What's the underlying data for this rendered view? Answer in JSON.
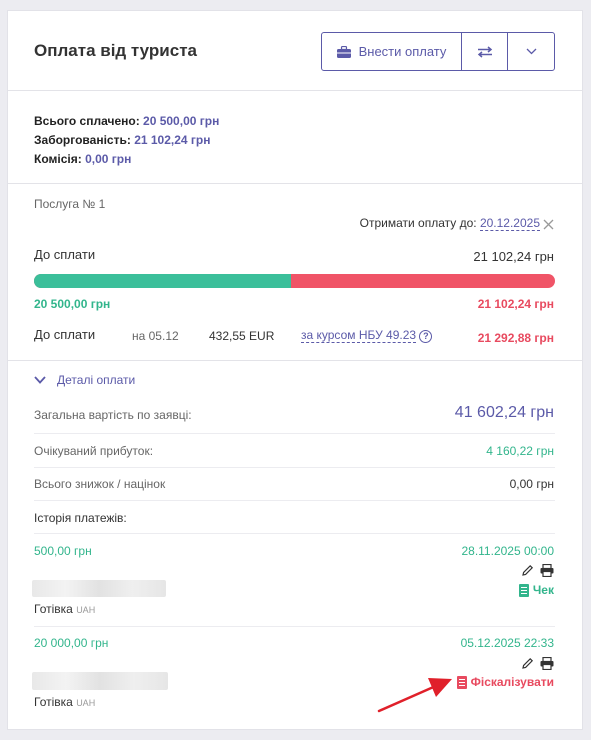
{
  "header": {
    "title": "Оплата від туриста",
    "pay_button_label": "Внести оплату"
  },
  "summary": {
    "paid_label": "Всього сплачено:",
    "paid_value": "20 500,00 грн",
    "debt_label": "Заборгованість:",
    "debt_value": "21 102,24 грн",
    "commission_label": "Комісія:",
    "commission_value": "0,00 грн"
  },
  "service": {
    "title": "Послуга № 1",
    "deadline_label": "Отримати оплату до:",
    "deadline_value": "20.12.2025",
    "to_pay_label": "До сплати",
    "to_pay_value": "21 102,24 грн",
    "paid_fraction": 0.493,
    "paid_amount": "20 500,00 грн",
    "remaining_amount": "21 102,24 грн",
    "conversion": {
      "label": "До сплати",
      "date": "на 05.12",
      "amount": "432,55 EUR",
      "rate_label": "за курсом НБУ 49.23",
      "total": "21 292,88 грн"
    }
  },
  "details": {
    "toggle_label": "Деталі оплати",
    "total_cost_label": "Загальна вартість по заявці:",
    "total_cost_value": "41 602,24 грн",
    "profit_label": "Очікуваний прибуток:",
    "profit_value": "4 160,22 грн",
    "discounts_label": "Всього знижок / націнок",
    "discounts_value": "0,00 грн",
    "history_label": "Історія платежів:"
  },
  "payments": [
    {
      "amount": "500,00 грн",
      "datetime": "28.11.2025 00:00",
      "method": "Готівка",
      "currency": "UAH",
      "receipt_label": "Чек"
    },
    {
      "amount": "20 000,00 грн",
      "datetime": "05.12.2025 22:33",
      "method": "Готівка",
      "currency": "UAH",
      "fiscal_label": "Фіскалізувати"
    }
  ],
  "colors": {
    "accent": "#5b5aa8",
    "green": "#32b58c",
    "red": "#e84a5f"
  }
}
